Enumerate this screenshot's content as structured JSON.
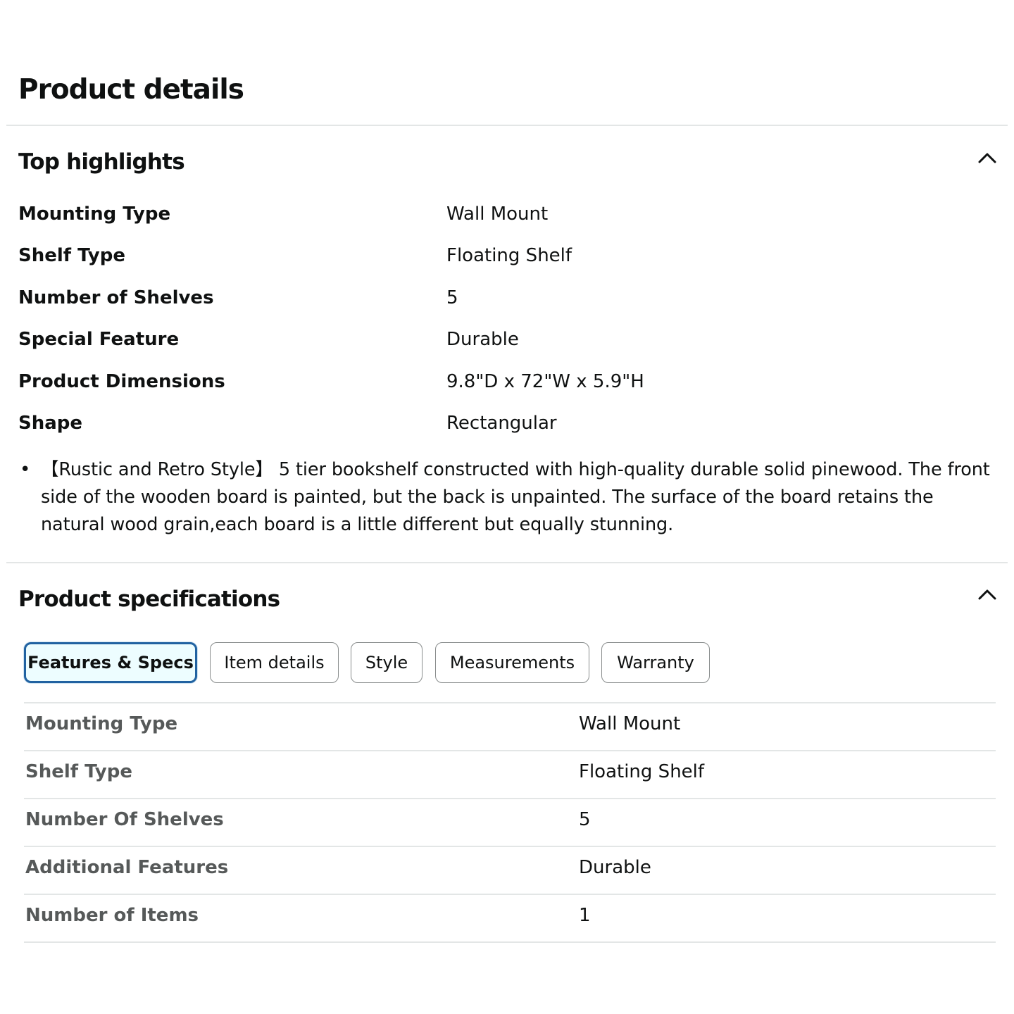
{
  "page_title": "Product details",
  "top_highlights": {
    "heading": "Top highlights",
    "rows": [
      {
        "label": "Mounting Type",
        "value": "Wall Mount"
      },
      {
        "label": "Shelf Type",
        "value": "Floating Shelf"
      },
      {
        "label": "Number of Shelves",
        "value": "5"
      },
      {
        "label": "Special Feature",
        "value": "Durable"
      },
      {
        "label": "Product Dimensions",
        "value": "9.8\"D x 72\"W x 5.9\"H"
      },
      {
        "label": "Shape",
        "value": "Rectangular"
      }
    ],
    "bullets": [
      "【Rustic and Retro Style】 5 tier bookshelf constructed with high-quality durable solid pinewood. The front side of the wooden board is painted, but the back is unpainted. The surface of the board retains the natural wood grain,each board is a little different but equally stunning."
    ]
  },
  "product_specifications": {
    "heading": "Product specifications",
    "tabs": [
      {
        "label": "Features & Specs",
        "active": true
      },
      {
        "label": "Item details",
        "active": false
      },
      {
        "label": "Style",
        "active": false
      },
      {
        "label": "Measurements",
        "active": false
      },
      {
        "label": "Warranty",
        "active": false
      }
    ],
    "rows": [
      {
        "label": "Mounting Type",
        "value": "Wall Mount"
      },
      {
        "label": "Shelf Type",
        "value": "Floating Shelf"
      },
      {
        "label": "Number Of Shelves",
        "value": "5"
      },
      {
        "label": "Additional Features",
        "value": "Durable"
      },
      {
        "label": "Number of Items",
        "value": "1"
      }
    ]
  },
  "icons": {
    "collapse": "chevron-up-icon",
    "bullet": "bullet-dot-icon"
  },
  "colors": {
    "text": "#0f1111",
    "secondary_text": "#565959",
    "divider": "#e3e6e6",
    "active_tab_border": "#2162a1",
    "active_tab_bg": "#edfdff"
  }
}
